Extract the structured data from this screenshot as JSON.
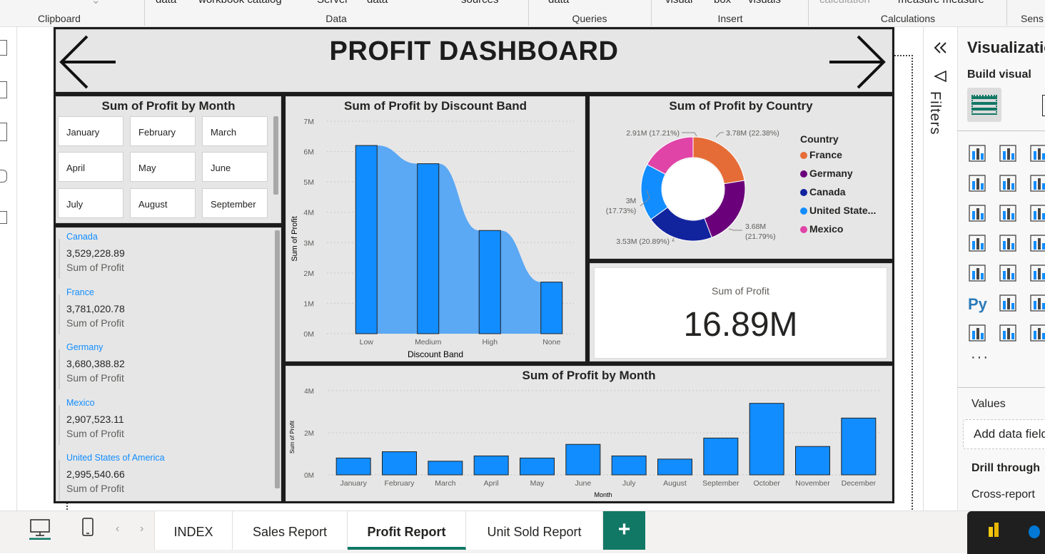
{
  "ribbon": {
    "cut_top": [
      "data",
      "workbook catalog",
      "Server",
      "data",
      "sources",
      "data",
      "visual",
      "box",
      "visuals",
      "calculation",
      "measure measure"
    ],
    "groups": [
      "Clipboard",
      "Data",
      "Queries",
      "Insert",
      "Calculations",
      "Sens"
    ]
  },
  "header": {
    "title": "PROFIT DASHBOARD",
    "back_icon": "arrow-left-icon",
    "forward_icon": "arrow-right-icon"
  },
  "slicer": {
    "title": "Sum of Profit by Month",
    "items": [
      "January",
      "February",
      "March",
      "April",
      "May",
      "June",
      "July",
      "August",
      "September"
    ]
  },
  "multi_card": {
    "entries": [
      {
        "category": "Canada",
        "value": "3,529,228.89",
        "label": "Sum of Profit"
      },
      {
        "category": "France",
        "value": "3,781,020.78",
        "label": "Sum of Profit"
      },
      {
        "category": "Germany",
        "value": "3,680,388.82",
        "label": "Sum of Profit"
      },
      {
        "category": "Mexico",
        "value": "2,907,523.11",
        "label": "Sum of Profit"
      },
      {
        "category": "United States of America",
        "value": "2,995,540.66",
        "label": "Sum of Profit"
      }
    ]
  },
  "discount_chart": {
    "title": "Sum of Profit by Discount Band",
    "xlabel": "Discount Band",
    "ylabel": "Sum of Profit",
    "yticks": [
      "0M",
      "1M",
      "2M",
      "3M",
      "4M",
      "5M",
      "6M",
      "7M"
    ]
  },
  "country_chart": {
    "title": "Sum of Profit by Country",
    "legend_title": "Country",
    "legend": [
      "France",
      "Germany",
      "Canada",
      "United State...",
      "Mexico"
    ],
    "labels": {
      "mexico": "2.91M (17.21%)",
      "france": "3.78M (22.38%)",
      "usa_1": "3M",
      "usa_2": "(17.73%)",
      "germany_1": "3.68M",
      "germany_2": "(21.79%)",
      "canada": "3.53M (20.89%)"
    }
  },
  "kpi": {
    "label": "Sum of Profit",
    "value": "16.89M"
  },
  "monthly_chart": {
    "title": "Sum of Profit by Month",
    "xlabel": "Month",
    "ylabel": "Sum of Profit",
    "yticks": [
      "0M",
      "2M",
      "4M"
    ]
  },
  "chart_data": [
    {
      "type": "bar",
      "title": "Sum of Profit by Discount Band",
      "xlabel": "Discount Band",
      "ylabel": "Sum of Profit",
      "categories": [
        "Low",
        "Medium",
        "High",
        "None"
      ],
      "values": [
        6.2,
        5.6,
        3.4,
        1.7
      ],
      "unit": "M",
      "ylim": [
        0,
        7
      ],
      "grid": true,
      "color": "#118dff"
    },
    {
      "type": "pie",
      "title": "Sum of Profit by Country",
      "categories": [
        "France",
        "Germany",
        "Canada",
        "United States of America",
        "Mexico"
      ],
      "values": [
        3.78,
        3.68,
        3.53,
        3.0,
        2.91
      ],
      "percents": [
        22.38,
        21.79,
        20.89,
        17.73,
        17.21
      ],
      "colors": [
        "#e66c37",
        "#6b007b",
        "#12239e",
        "#118dff",
        "#e044a7"
      ],
      "legend": "right"
    },
    {
      "type": "bar",
      "title": "Sum of Profit by Month",
      "xlabel": "Month",
      "ylabel": "Sum of Profit",
      "categories": [
        "January",
        "February",
        "March",
        "April",
        "May",
        "June",
        "July",
        "August",
        "September",
        "October",
        "November",
        "December"
      ],
      "values": [
        0.8,
        1.1,
        0.65,
        0.9,
        0.8,
        1.45,
        0.9,
        0.75,
        1.75,
        3.4,
        1.35,
        2.7
      ],
      "unit": "M",
      "ylim": [
        0,
        4
      ],
      "grid": true,
      "color": "#118dff"
    }
  ],
  "filters_pane": {
    "label": "Filters",
    "collapse_icon": "double-chevron-left-icon"
  },
  "viz_pane": {
    "title": "Visualizations",
    "build_visual": "Build visual",
    "values": "Values",
    "add_field": "Add data fields here",
    "drill": "Drill through",
    "cross": "Cross-report"
  },
  "pages": {
    "tabs": [
      "INDEX",
      "Sales Report",
      "Profit Report",
      "Unit Sold Report"
    ],
    "active": "Profit Report",
    "add": "+"
  }
}
